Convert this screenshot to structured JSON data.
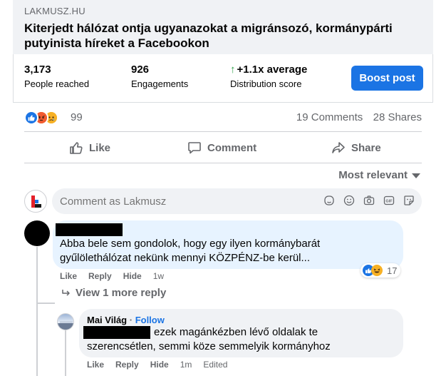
{
  "link_preview": {
    "domain": "LAKMUSZ.HU",
    "title_line1": "Kiterjedt hálózat ontja ugyanazokat a migránsozó, kormánypárti",
    "title_line2": "putyinista híreket a Facebookon"
  },
  "insights": {
    "people_reached": "3,173",
    "people_reached_label": "People reached",
    "engagements": "926",
    "engagements_label": "Engagements",
    "distribution": "+1.1x average",
    "distribution_label": "Distribution score",
    "boost_label": "Boost post"
  },
  "reactions": {
    "count": "99",
    "comments": "19 Comments",
    "shares": "28 Shares",
    "icons": [
      "like-icon",
      "angry-icon",
      "sad-icon"
    ]
  },
  "actions": {
    "like": "Like",
    "comment": "Comment",
    "share": "Share"
  },
  "sort": {
    "label": "Most relevant"
  },
  "composer": {
    "placeholder": "Comment as Lakmusz"
  },
  "comment1": {
    "line1": "Abba bele sem gondolok, hogy egy ilyen kormánybarát",
    "line2": "gyűlölethálózat nekünk mennyi KÖZPÉNZ-be kerül...",
    "like": "Like",
    "reply": "Reply",
    "hide": "Hide",
    "time": "1w",
    "reaction_count": "17"
  },
  "view_more": "View 1 more reply",
  "reply1": {
    "author": "Mai Világ",
    "separator": " · ",
    "follow": "Follow",
    "line1": "ezek magánkézben lévő oldalak te",
    "line2": "szerencsétlen, semmi köze semmelyik kormányhoz",
    "like": "Like",
    "reply": "Reply",
    "hide": "Hide",
    "time": "1m",
    "edited": "Edited"
  },
  "colors": {
    "accent": "#1b74e4",
    "positive": "#31a24c",
    "muted": "#65676b"
  }
}
